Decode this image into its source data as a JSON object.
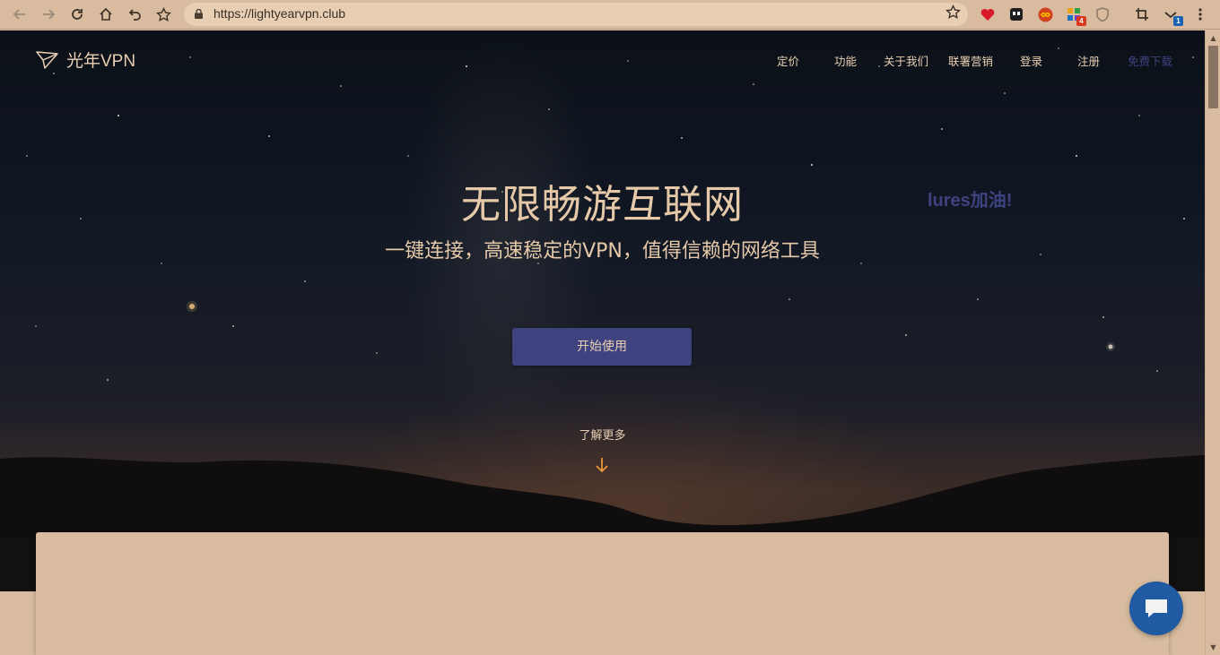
{
  "browser": {
    "url": "https://lightyearvpn.club",
    "extensions": [
      {
        "name": "heart-extension-icon"
      },
      {
        "name": "ghost-extension-icon"
      },
      {
        "name": "infinity-extension-icon"
      },
      {
        "name": "puzzle-extension-icon",
        "badge": "4"
      },
      {
        "name": "shield-extension-icon"
      },
      {
        "name": "crop-extension-icon"
      },
      {
        "name": "check-extension-icon",
        "badge": "1"
      }
    ]
  },
  "site": {
    "logo_text": "光年VPN",
    "nav": [
      "定价",
      "功能",
      "关于我们",
      "联署营销",
      "登录",
      "注册",
      "免费下载"
    ],
    "headline": "无限畅游互联网",
    "tagline": "一键连接，高速稳定的VPN，值得信赖的网络工具",
    "overlay_message": "lures加油!",
    "cta_label": "开始使用",
    "learn_more": "了解更多"
  },
  "colors": {
    "accent": "#3e4380",
    "text_light": "#e9cfb2",
    "page_bg": "#d9bc9f",
    "chat_bubble": "#1f5aa3"
  }
}
